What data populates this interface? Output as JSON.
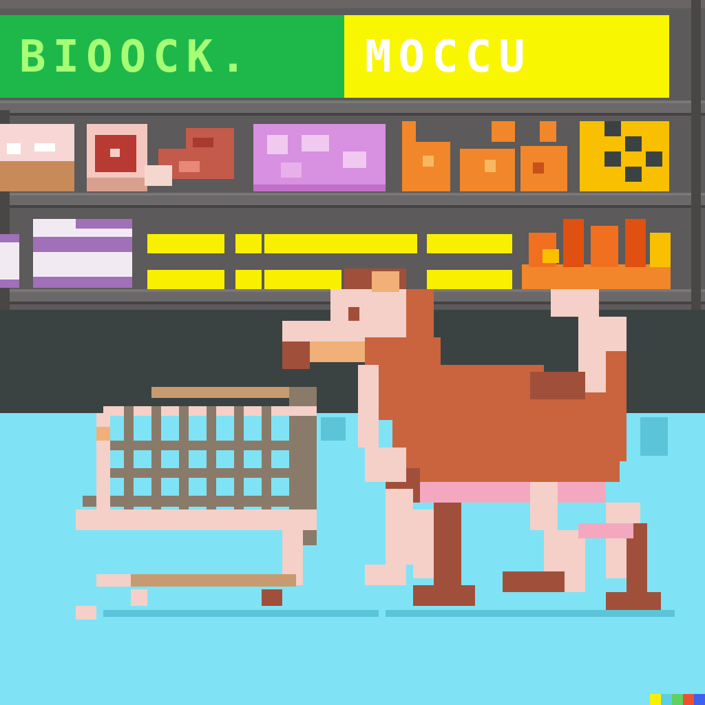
{
  "sign": {
    "left_text": "BIOOCK.",
    "right_text": "MOCCU"
  },
  "shelf_items_top": [
    {
      "name": "cake-item",
      "color": "#f6d7d6"
    },
    {
      "name": "steak-item",
      "color": "#b83a32"
    },
    {
      "name": "raw-meat-item",
      "color": "#c45a4a"
    },
    {
      "name": "candy-item",
      "color": "#d890e0"
    },
    {
      "name": "orange-product-item",
      "color": "#f2862a"
    },
    {
      "name": "cheese-item",
      "color": "#f8c000"
    }
  ],
  "icons": {
    "character": "horse-icon",
    "cart": "shopping-cart-icon",
    "watermark": "color-strip-icon"
  },
  "colors": {
    "green_sign": "#1eb84a",
    "yellow_sign": "#f8f600",
    "floor": "#7fe3f5",
    "horse": "#c9643e"
  }
}
